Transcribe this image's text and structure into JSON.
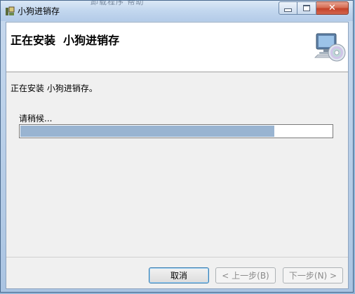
{
  "window": {
    "title": "小狗进销存",
    "background_ghost_text": "卸载程序 帮助",
    "close_glyph": "✕"
  },
  "header": {
    "title": "正在安装  小狗进销存",
    "icon": "computer-cd-icon"
  },
  "body": {
    "status_text": "正在安装 小狗进销存。",
    "wait_label": "请稍候...",
    "progress": 0.816
  },
  "buttons": {
    "cancel": "取消",
    "back": "< 上一步(B)",
    "next": "下一步(N) >"
  },
  "colors": {
    "progress_fill": "#99b4d1",
    "client_bg": "#f0f0f0",
    "close_button": "#c4432a"
  }
}
